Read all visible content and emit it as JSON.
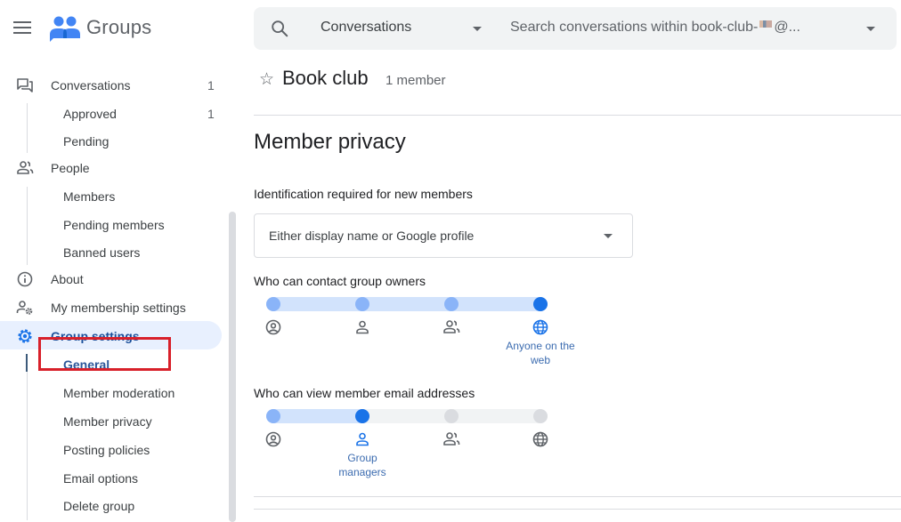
{
  "brand": {
    "name": "Groups",
    "logo_icon": "google-groups-logo"
  },
  "search": {
    "scope": "Conversations",
    "placeholder_prefix": "Search conversations within book-club-",
    "placeholder_suffix": "@..."
  },
  "sidebar": {
    "items": [
      {
        "id": "conversations",
        "label": "Conversations",
        "count": "1",
        "icon": "forum-icon",
        "level": 0
      },
      {
        "id": "approved",
        "label": "Approved",
        "count": "1",
        "level": 1
      },
      {
        "id": "pending",
        "label": "Pending",
        "level": 1
      },
      {
        "id": "people",
        "label": "People",
        "icon": "people-icon",
        "level": 0
      },
      {
        "id": "members",
        "label": "Members",
        "level": 1
      },
      {
        "id": "pending-members",
        "label": "Pending members",
        "level": 1
      },
      {
        "id": "banned-users",
        "label": "Banned users",
        "level": 1
      },
      {
        "id": "about",
        "label": "About",
        "icon": "info-icon",
        "level": 0
      },
      {
        "id": "my-membership-settings",
        "label": "My membership settings",
        "icon": "person-settings-icon",
        "level": 0
      },
      {
        "id": "group-settings",
        "label": "Group settings",
        "icon": "gear-icon",
        "level": 0,
        "active": true
      },
      {
        "id": "general",
        "label": "General",
        "level": 1,
        "current": true
      },
      {
        "id": "member-moderation",
        "label": "Member moderation",
        "level": 1
      },
      {
        "id": "member-privacy",
        "label": "Member privacy",
        "level": 1,
        "highlighted": true
      },
      {
        "id": "posting-policies",
        "label": "Posting policies",
        "level": 1
      },
      {
        "id": "email-options",
        "label": "Email options",
        "level": 1
      },
      {
        "id": "delete-group",
        "label": "Delete group",
        "level": 1
      }
    ]
  },
  "group": {
    "title": "Book club",
    "member_count": "1 member"
  },
  "main": {
    "section_title": "Member privacy",
    "identification": {
      "label": "Identification required for new members",
      "value": "Either display name or Google profile"
    },
    "contact_owners": {
      "label": "Who can contact group owners",
      "stops": [
        "Group owners",
        "Group managers",
        "Group members",
        "Anyone on the web"
      ],
      "stop_icons": [
        "account-circle-icon",
        "person-icon",
        "group-icon",
        "globe-icon"
      ],
      "selected_index": 3,
      "selected_label": "Anyone on the web"
    },
    "view_emails": {
      "label": "Who can view member email addresses",
      "stops": [
        "Group owners",
        "Group managers",
        "Group members",
        "Anyone on the web"
      ],
      "stop_icons": [
        "account-circle-icon",
        "person-icon",
        "group-icon",
        "globe-icon"
      ],
      "selected_index": 1,
      "selected_label": "Group managers"
    }
  },
  "colors": {
    "accent": "#1a73e8",
    "fill_light": "#d2e3fc",
    "stop_passed": "#8ab4f8",
    "stop_inactive": "#dadce0",
    "active_nav_bg": "#e8f0fe",
    "highlight_box": "#d8202a"
  }
}
